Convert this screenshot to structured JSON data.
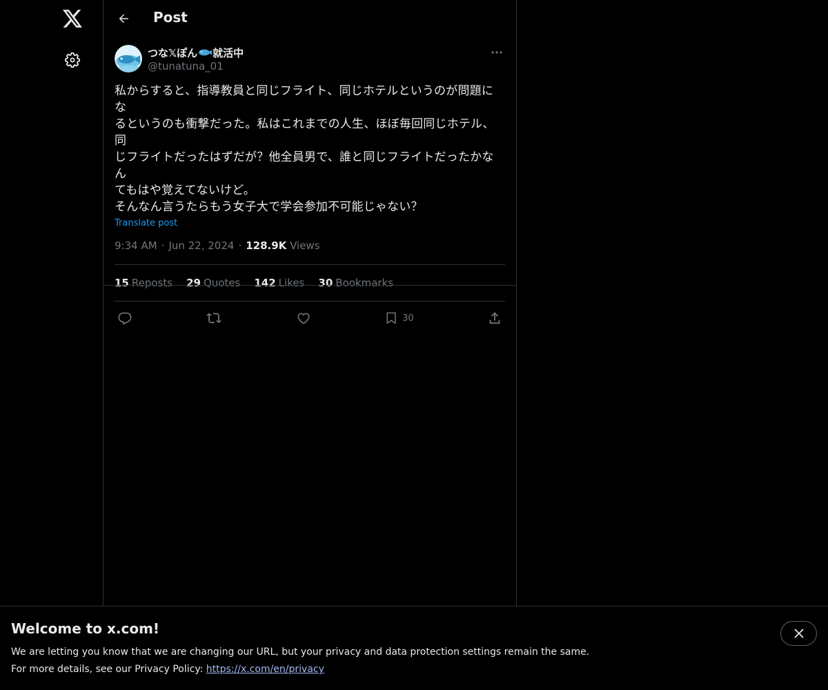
{
  "header": {
    "title": "Post"
  },
  "post": {
    "author_name_prefix": "つな𝕏ぽん",
    "author_name_suffix": "就活中",
    "author_handle": "@tunatuna_01",
    "text": "私からすると、指導教員と同じフライト、同じホテルというのが問題にな\nるというのも衝撃だった。私はこれまでの人生、ほぼ毎回同じホテル、同\nじフライトだったはずだが？他全員男で、誰と同じフライトだったかなん\nてもはや覚えてないけど。\nそんなん言うたらもう女子大で学会参加不可能じゃない？",
    "translate_label": "Translate post",
    "time": "9:34 AM",
    "date": "Jun 22, 2024",
    "views_count": "128.9K",
    "views_label": "Views"
  },
  "stats": [
    {
      "num": "15",
      "label": "Reposts"
    },
    {
      "num": "29",
      "label": "Quotes"
    },
    {
      "num": "142",
      "label": "Likes"
    },
    {
      "num": "30",
      "label": "Bookmarks"
    }
  ],
  "actions": {
    "bookmark_count": "30"
  },
  "banner": {
    "title": "Welcome to x.com!",
    "line1": "We are letting you know that we are changing our URL, but your privacy and data protection settings remain the same.",
    "line2_prefix": "For more details, see our Privacy Policy: ",
    "link_text": "https://x.com/en/privacy"
  },
  "icons": {
    "logo": "x-logo-icon",
    "settings": "gear-icon",
    "back": "arrow-left-icon",
    "more": "more-dots-icon",
    "reply": "reply-icon",
    "repost": "repost-icon",
    "like": "heart-icon",
    "bookmark": "bookmark-icon",
    "share": "share-icon",
    "close": "close-icon",
    "fish": "fish-emoji-icon"
  },
  "colors": {
    "background": "#000000",
    "text_primary": "#e7e9ea",
    "text_secondary": "#71767b",
    "link": "#1d9bf0",
    "border": "#2f3336"
  }
}
